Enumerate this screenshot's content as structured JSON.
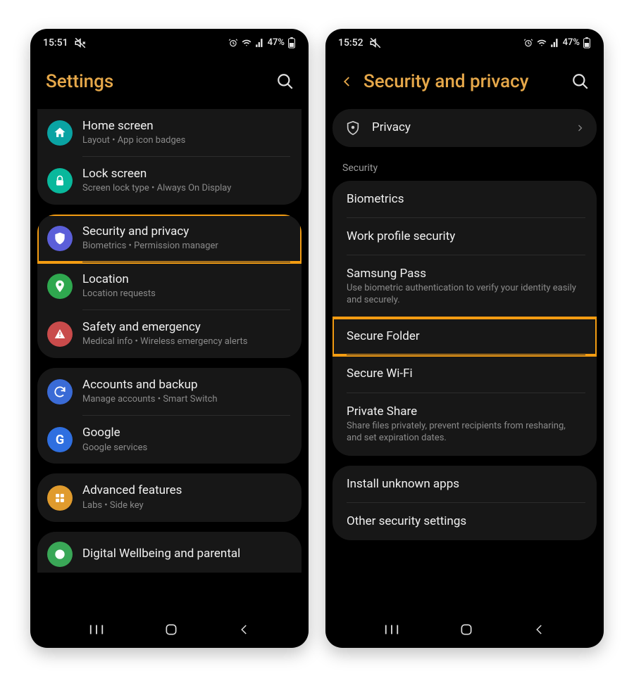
{
  "left": {
    "status": {
      "time": "15:51",
      "battery": "47%"
    },
    "title": "Settings",
    "items": [
      {
        "title": "Home screen",
        "sub": "Layout  •  App icon badges"
      },
      {
        "title": "Lock screen",
        "sub": "Screen lock type  •  Always On Display"
      },
      {
        "title": "Security and privacy",
        "sub": "Biometrics  •  Permission manager"
      },
      {
        "title": "Location",
        "sub": "Location requests"
      },
      {
        "title": "Safety and emergency",
        "sub": "Medical info  •  Wireless emergency alerts"
      },
      {
        "title": "Accounts and backup",
        "sub": "Manage accounts  •  Smart Switch"
      },
      {
        "title": "Google",
        "sub": "Google services"
      },
      {
        "title": "Advanced features",
        "sub": "Labs  •  Side key"
      },
      {
        "title": "Digital Wellbeing and parental",
        "sub": ""
      }
    ]
  },
  "right": {
    "status": {
      "time": "15:52",
      "battery": "47%"
    },
    "title": "Security and privacy",
    "privacy": "Privacy",
    "section": "Security",
    "items": [
      {
        "title": "Biometrics",
        "sub": ""
      },
      {
        "title": "Work profile security",
        "sub": ""
      },
      {
        "title": "Samsung Pass",
        "sub": "Use biometric authentication to verify your identity easily and securely."
      },
      {
        "title": "Secure Folder",
        "sub": ""
      },
      {
        "title": "Secure Wi-Fi",
        "sub": ""
      },
      {
        "title": "Private Share",
        "sub": "Share files privately, prevent recipients from resharing, and set expiration dates."
      }
    ],
    "items2": [
      {
        "title": "Install unknown apps"
      },
      {
        "title": "Other security settings"
      }
    ]
  }
}
